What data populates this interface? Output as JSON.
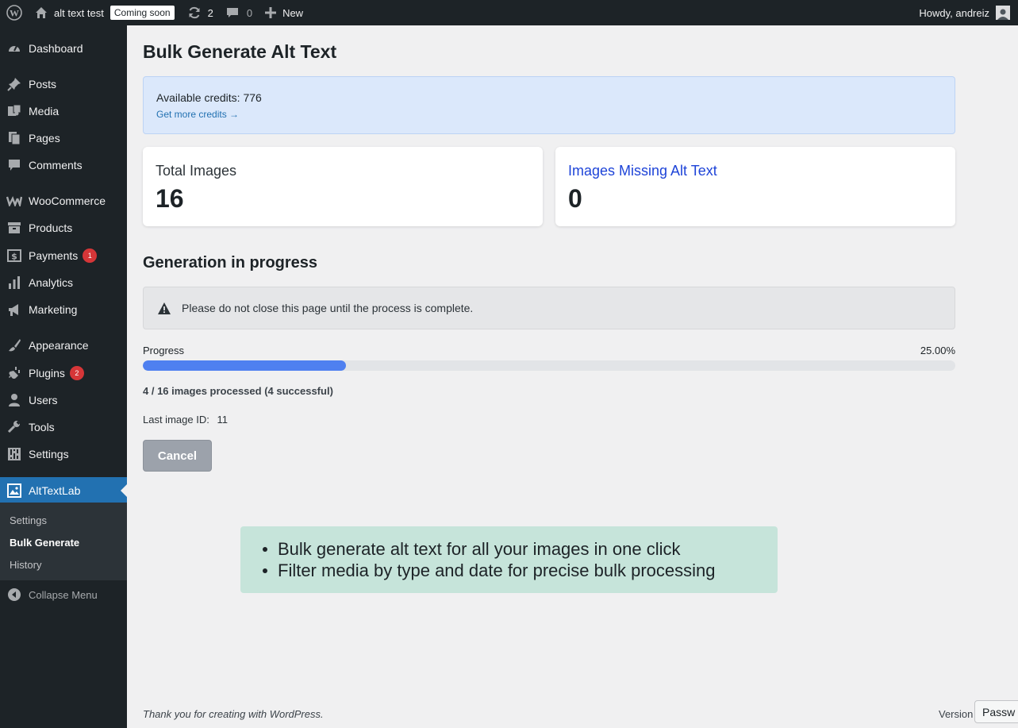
{
  "adminbar": {
    "site_name": "alt text test",
    "badge": "Coming soon",
    "updates_count": "2",
    "comments_count": "0",
    "new_label": "New",
    "greeting": "Howdy, andreiz"
  },
  "sidebar": {
    "items": [
      {
        "label": "Dashboard",
        "icon": "dashboard-icon"
      },
      {
        "label": "Posts",
        "icon": "pin-icon"
      },
      {
        "label": "Media",
        "icon": "media-icon"
      },
      {
        "label": "Pages",
        "icon": "pages-icon"
      },
      {
        "label": "Comments",
        "icon": "comment-icon"
      },
      {
        "label": "WooCommerce",
        "icon": "woocommerce-icon"
      },
      {
        "label": "Products",
        "icon": "archive-icon"
      },
      {
        "label": "Payments",
        "icon": "dollar-icon",
        "badge": "1"
      },
      {
        "label": "Analytics",
        "icon": "bar-chart-icon"
      },
      {
        "label": "Marketing",
        "icon": "megaphone-icon"
      },
      {
        "label": "Appearance",
        "icon": "brush-icon"
      },
      {
        "label": "Plugins",
        "icon": "plug-icon",
        "badge": "2"
      },
      {
        "label": "Users",
        "icon": "user-icon"
      },
      {
        "label": "Tools",
        "icon": "wrench-icon"
      },
      {
        "label": "Settings",
        "icon": "sliders-icon"
      },
      {
        "label": "AltTextLab",
        "icon": "image-icon"
      }
    ],
    "submenu": [
      "Settings",
      "Bulk Generate",
      "History"
    ],
    "collapse_label": "Collapse Menu"
  },
  "main": {
    "title": "Bulk Generate Alt Text",
    "credits_text": "Available credits: 776",
    "credits_link": "Get more credits →",
    "total_images_label": "Total Images",
    "total_images_value": "16",
    "missing_label": "Images Missing Alt Text",
    "missing_value": "0",
    "section_title": "Generation in progress",
    "notice": "Please do not close this page until the process is complete.",
    "progress_label": "Progress",
    "progress_percent": "25.00%",
    "progress_fraction": 0.25,
    "processed_text": "4 / 16 images processed (4 successful)",
    "last_image_label": "Last image ID:",
    "last_image_value": "11",
    "cancel_label": "Cancel"
  },
  "callout": {
    "items": [
      "Bulk generate alt text for all your images in one click",
      "Filter media by type and date for precise bulk processing"
    ]
  },
  "footer": {
    "thanks": "Thank you for creating with WordPress.",
    "version": "Version",
    "password_tab": "Passw"
  },
  "colors": {
    "admin_bg": "#1d2327",
    "accent": "#2271b1",
    "progress": "#4f80f0",
    "badge_red": "#d63638",
    "callout_bg": "#c6e4da"
  }
}
